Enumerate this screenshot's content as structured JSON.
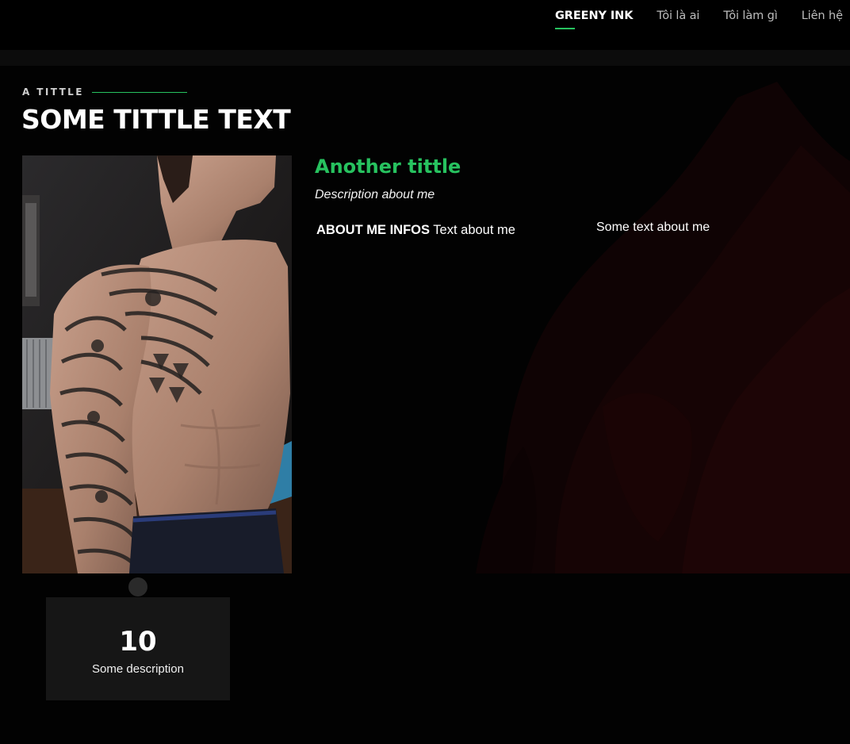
{
  "nav": {
    "items": [
      {
        "label": "GREENY INK",
        "active": true
      },
      {
        "label": "Tôi là ai",
        "active": false
      },
      {
        "label": "Tôi làm gì",
        "active": false
      },
      {
        "label": "Liên hệ",
        "active": false
      }
    ]
  },
  "section": {
    "eyebrow": "A TITTLE",
    "title": "SOME TITTLE TEXT"
  },
  "about": {
    "title": "Another tittle",
    "description": "Description about me",
    "infos_label": "ABOUT ME INFOS",
    "infos_text": "Text about me",
    "side_text": "Some text about me"
  },
  "counter": {
    "value": "10",
    "label": "Some description"
  },
  "colors": {
    "accent": "#27c25f",
    "background": "#020202",
    "card": "#161616"
  }
}
